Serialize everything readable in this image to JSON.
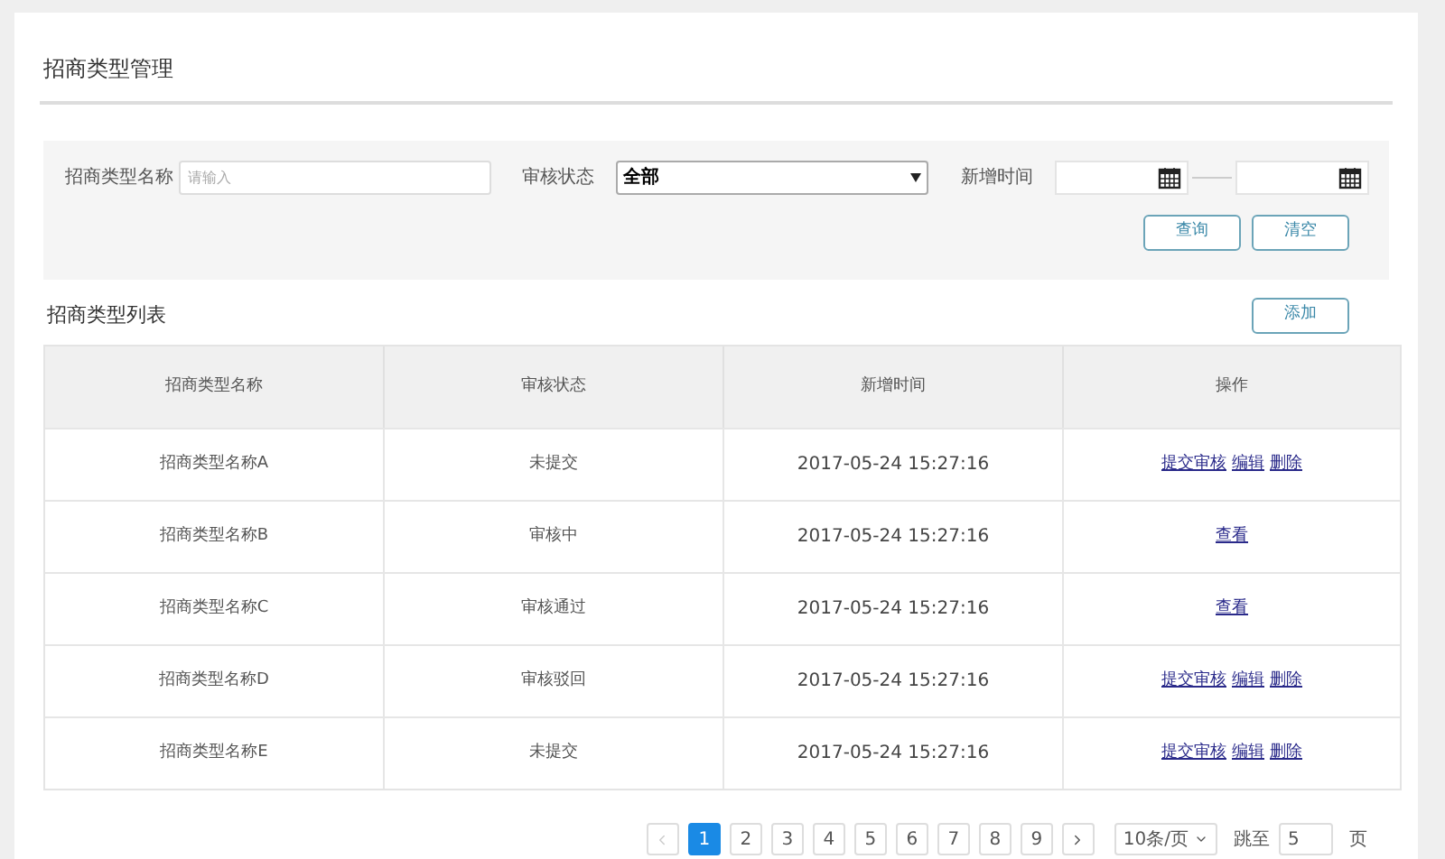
{
  "page_title": "招商类型管理",
  "filters": {
    "name_label": "招商类型名称",
    "name_placeholder": "请输入",
    "status_label": "审核状态",
    "status_value": "全部",
    "time_label": "新增时间",
    "buttons": [
      "查询",
      "清空"
    ]
  },
  "list_title": "招商类型列表",
  "add_button": "添加",
  "table": {
    "columns": [
      "招商类型名称",
      "审核状态",
      "新增时间",
      "操作"
    ],
    "rows": [
      {
        "name": "招商类型名称A",
        "status": "未提交",
        "time": "2017-05-24 15:27:16",
        "actions": [
          "提交审核",
          "编辑",
          "删除"
        ]
      },
      {
        "name": "招商类型名称B",
        "status": "审核中",
        "time": "2017-05-24 15:27:16",
        "actions": [
          "查看"
        ]
      },
      {
        "name": "招商类型名称C",
        "status": "审核通过",
        "time": "2017-05-24 15:27:16",
        "actions": [
          "查看"
        ]
      },
      {
        "name": "招商类型名称D",
        "status": "审核驳回",
        "time": "2017-05-24 15:27:16",
        "actions": [
          "提交审核",
          "编辑",
          "删除"
        ]
      },
      {
        "name": "招商类型名称E",
        "status": "未提交",
        "time": "2017-05-24 15:27:16",
        "actions": [
          "提交审核",
          "编辑",
          "删除"
        ]
      }
    ]
  },
  "pagination": {
    "prev_disabled": true,
    "pages": [
      {
        "label": "1",
        "selected": true
      },
      {
        "label": "2",
        "selected": false
      },
      {
        "label": "3",
        "selected": false
      },
      {
        "label": "4",
        "selected": false
      },
      {
        "label": "5",
        "selected": false
      },
      {
        "label": "6",
        "selected": false
      },
      {
        "label": "7",
        "selected": false
      },
      {
        "label": "8",
        "selected": false
      },
      {
        "label": "9",
        "selected": false
      }
    ],
    "page_size": "10条/页",
    "jump_label": "跳至",
    "jump_value": "5",
    "page_unit": "页"
  }
}
